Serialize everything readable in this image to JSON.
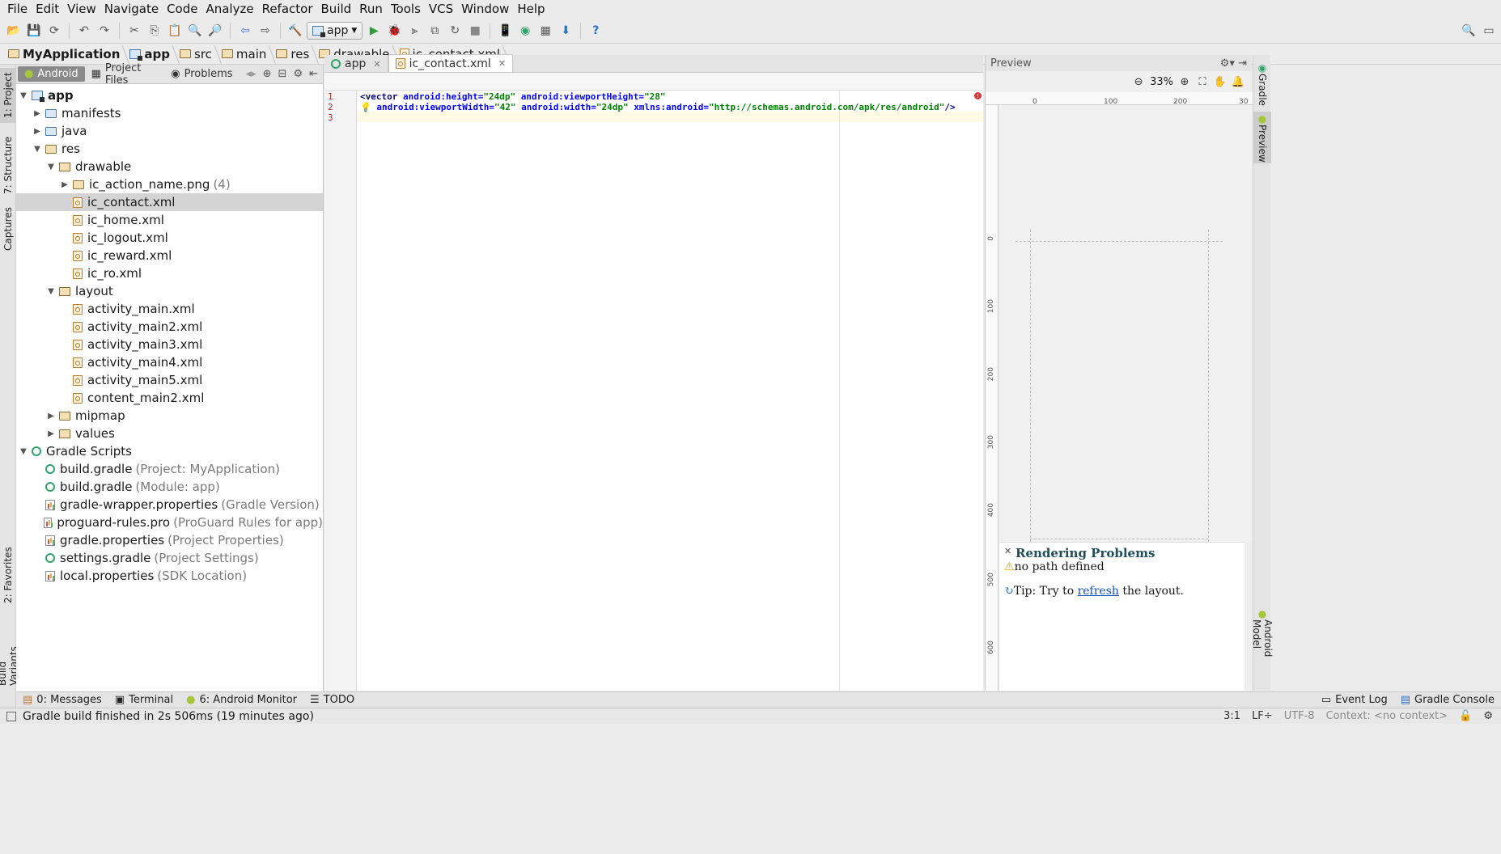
{
  "menu": [
    "File",
    "Edit",
    "View",
    "Navigate",
    "Code",
    "Analyze",
    "Refactor",
    "Build",
    "Run",
    "Tools",
    "VCS",
    "Window",
    "Help"
  ],
  "toolbar": {
    "run_config": "app"
  },
  "breadcrumb": [
    "MyApplication",
    "app",
    "src",
    "main",
    "res",
    "drawable",
    "ic_contact.xml"
  ],
  "left_strip": {
    "project": "1: Project",
    "structure": "7: Structure",
    "captures": "Captures",
    "favorites": "2: Favorites",
    "build_variants": "Build Variants"
  },
  "project_panel": {
    "tabs": [
      "Android",
      "Project Files",
      "Problems"
    ],
    "tree": [
      {
        "label": "app",
        "indent": 0,
        "arrow": "down",
        "icon": "module",
        "bold": true
      },
      {
        "label": "manifests",
        "indent": 1,
        "arrow": "right",
        "icon": "folder-blue"
      },
      {
        "label": "java",
        "indent": 1,
        "arrow": "right",
        "icon": "folder-blue"
      },
      {
        "label": "res",
        "indent": 1,
        "arrow": "down",
        "icon": "folder"
      },
      {
        "label": "drawable",
        "indent": 2,
        "arrow": "down",
        "icon": "folder"
      },
      {
        "label": "ic_action_name.png",
        "hint": "(4)",
        "indent": 3,
        "arrow": "right",
        "icon": "folder"
      },
      {
        "label": "ic_contact.xml",
        "indent": 3,
        "arrow": "",
        "icon": "xml",
        "selected": true
      },
      {
        "label": "ic_home.xml",
        "indent": 3,
        "arrow": "",
        "icon": "xml"
      },
      {
        "label": "ic_logout.xml",
        "indent": 3,
        "arrow": "",
        "icon": "xml"
      },
      {
        "label": "ic_reward.xml",
        "indent": 3,
        "arrow": "",
        "icon": "xml"
      },
      {
        "label": "ic_ro.xml",
        "indent": 3,
        "arrow": "",
        "icon": "xml"
      },
      {
        "label": "layout",
        "indent": 2,
        "arrow": "down",
        "icon": "folder"
      },
      {
        "label": "activity_main.xml",
        "indent": 3,
        "arrow": "",
        "icon": "xml"
      },
      {
        "label": "activity_main2.xml",
        "indent": 3,
        "arrow": "",
        "icon": "xml"
      },
      {
        "label": "activity_main3.xml",
        "indent": 3,
        "arrow": "",
        "icon": "xml"
      },
      {
        "label": "activity_main4.xml",
        "indent": 3,
        "arrow": "",
        "icon": "xml"
      },
      {
        "label": "activity_main5.xml",
        "indent": 3,
        "arrow": "",
        "icon": "xml"
      },
      {
        "label": "content_main2.xml",
        "indent": 3,
        "arrow": "",
        "icon": "xml"
      },
      {
        "label": "mipmap",
        "indent": 2,
        "arrow": "right",
        "icon": "folder"
      },
      {
        "label": "values",
        "indent": 2,
        "arrow": "right",
        "icon": "folder"
      },
      {
        "label": "Gradle Scripts",
        "indent": 0,
        "arrow": "down",
        "icon": "gradle"
      },
      {
        "label": "build.gradle",
        "hint": "(Project: MyApplication)",
        "indent": 1,
        "arrow": "",
        "icon": "gradle"
      },
      {
        "label": "build.gradle",
        "hint": "(Module: app)",
        "indent": 1,
        "arrow": "",
        "icon": "gradle"
      },
      {
        "label": "gradle-wrapper.properties",
        "hint": "(Gradle Version)",
        "indent": 1,
        "arrow": "",
        "icon": "props"
      },
      {
        "label": "proguard-rules.pro",
        "hint": "(ProGuard Rules for app)",
        "indent": 1,
        "arrow": "",
        "icon": "text"
      },
      {
        "label": "gradle.properties",
        "hint": "(Project Properties)",
        "indent": 1,
        "arrow": "",
        "icon": "props"
      },
      {
        "label": "settings.gradle",
        "hint": "(Project Settings)",
        "indent": 1,
        "arrow": "",
        "icon": "gradle"
      },
      {
        "label": "local.properties",
        "hint": "(SDK Location)",
        "indent": 1,
        "arrow": "",
        "icon": "props"
      }
    ]
  },
  "editor": {
    "tabs": [
      {
        "label": "app",
        "active": false
      },
      {
        "label": "ic_contact.xml",
        "active": true
      }
    ],
    "line_numbers": [
      "1",
      "2",
      "3"
    ],
    "line1": {
      "tag": "<vector",
      "a1": "android:height=",
      "v1": "\"24dp\"",
      "a2": "android:viewportHeight=",
      "v2": "\"28\""
    },
    "line2": {
      "a1": "android:viewportWidth=",
      "v1": "\"42\"",
      "a2": "android:width=",
      "v2": "\"24dp\"",
      "a3": "xmlns:android=",
      "v3": "\"http://schemas.android.com/apk/res/android\"",
      "end": "/>"
    }
  },
  "preview": {
    "title": "Preview",
    "zoom": "33%",
    "ruler_h": [
      "0",
      "100",
      "200",
      "30"
    ],
    "ruler_v": [
      "0",
      "100",
      "200",
      "300",
      "400",
      "500",
      "600"
    ],
    "problems_title": "Rendering Problems",
    "problem_text": "no path defined",
    "tip_prefix": "Tip: Try to",
    "tip_link": "refresh",
    "tip_suffix": "the layout."
  },
  "right_strip": {
    "gradle": "Gradle",
    "preview": "Preview",
    "android_model": "Android Model"
  },
  "bottom_tabs": {
    "messages": "0: Messages",
    "terminal": "Terminal",
    "android_monitor": "6: Android Monitor",
    "todo": "TODO",
    "event_log": "Event Log",
    "gradle_console": "Gradle Console"
  },
  "status": {
    "message": "Gradle build finished in 2s 506ms (19 minutes ago)",
    "position": "3:1",
    "line_sep": "LF÷",
    "encoding": "UTF-8",
    "context": "Context: <no context>"
  }
}
